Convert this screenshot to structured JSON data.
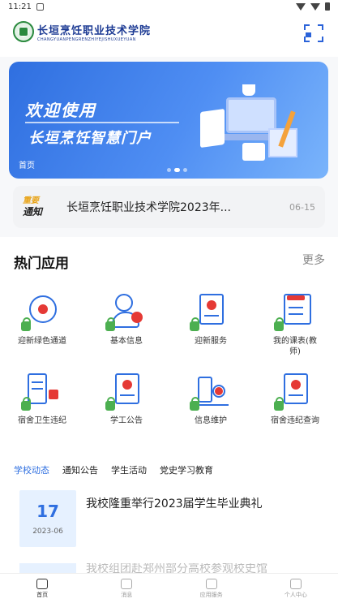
{
  "status_bar": {
    "time": "11:21"
  },
  "header": {
    "logo_cn": "长垣烹饪职业技术学院",
    "logo_en": "CHANGYUANPENGRENZHIYEJISHUXUEYUAN"
  },
  "banner": {
    "welcome": "欢迎使用",
    "title": "长垣烹饪智慧门户",
    "label": "首页",
    "slides": 3,
    "active_slide": 2
  },
  "notice": {
    "badge_top": "重要",
    "badge_bottom": "通知",
    "text": "长垣烹饪职业技术学院2023年...",
    "date": "06-15"
  },
  "hot_apps": {
    "title": "热门应用",
    "more": "更多",
    "items": [
      {
        "label": "迎新绿色通道",
        "icon": "money-bag-icon"
      },
      {
        "label": "基本信息",
        "icon": "user-info-icon"
      },
      {
        "label": "迎新服务",
        "icon": "service-doc-icon"
      },
      {
        "label": "我的课表(教师)",
        "icon": "schedule-icon"
      },
      {
        "label": "宿舍卫生违纪",
        "icon": "dorm-flag-icon"
      },
      {
        "label": "学工公告",
        "icon": "announcement-doc-icon"
      },
      {
        "label": "信息维护",
        "icon": "building-user-icon"
      },
      {
        "label": "宿舍违纪查询",
        "icon": "dorm-query-icon"
      }
    ]
  },
  "tabs": [
    "学校动态",
    "通知公告",
    "学生活动",
    "党史学习教育"
  ],
  "active_tab": 0,
  "news": [
    {
      "day": "17",
      "ym": "2023-06",
      "title": "我校隆重举行2023届学生毕业典礼"
    },
    {
      "title": "我校组团赴郑州部分高校参观校史馆"
    }
  ],
  "bottom_nav": [
    "首页",
    "消息",
    "应用服务",
    "个人中心"
  ],
  "colors": {
    "primary": "#2f6fe0",
    "accent_red": "#e53935",
    "lock_green": "#4caf50"
  }
}
